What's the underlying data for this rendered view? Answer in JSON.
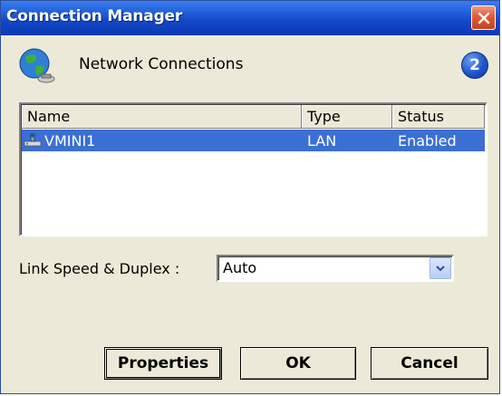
{
  "window": {
    "title": "Connection Manager"
  },
  "header": {
    "label": "Network Connections",
    "badge": "2"
  },
  "connections_table": {
    "columns": [
      "Name",
      "Type",
      "Status"
    ],
    "rows": [
      {
        "name": "VMINI1",
        "type": "LAN",
        "status": "Enabled",
        "selected": true
      }
    ]
  },
  "link_speed": {
    "label": "Link Speed & Duplex :",
    "value": "Auto"
  },
  "buttons": {
    "properties": "Properties",
    "ok": "OK",
    "cancel": "Cancel"
  },
  "icons": {
    "header": "network-globe-icon",
    "row": "network-adapter-icon",
    "close": "close-icon",
    "dropdown": "chevron-down-icon"
  },
  "colors": {
    "titlebar": "#1346c7",
    "selection": "#3b6fd4",
    "close_button": "#e05a37",
    "background": "#ece9d8"
  }
}
